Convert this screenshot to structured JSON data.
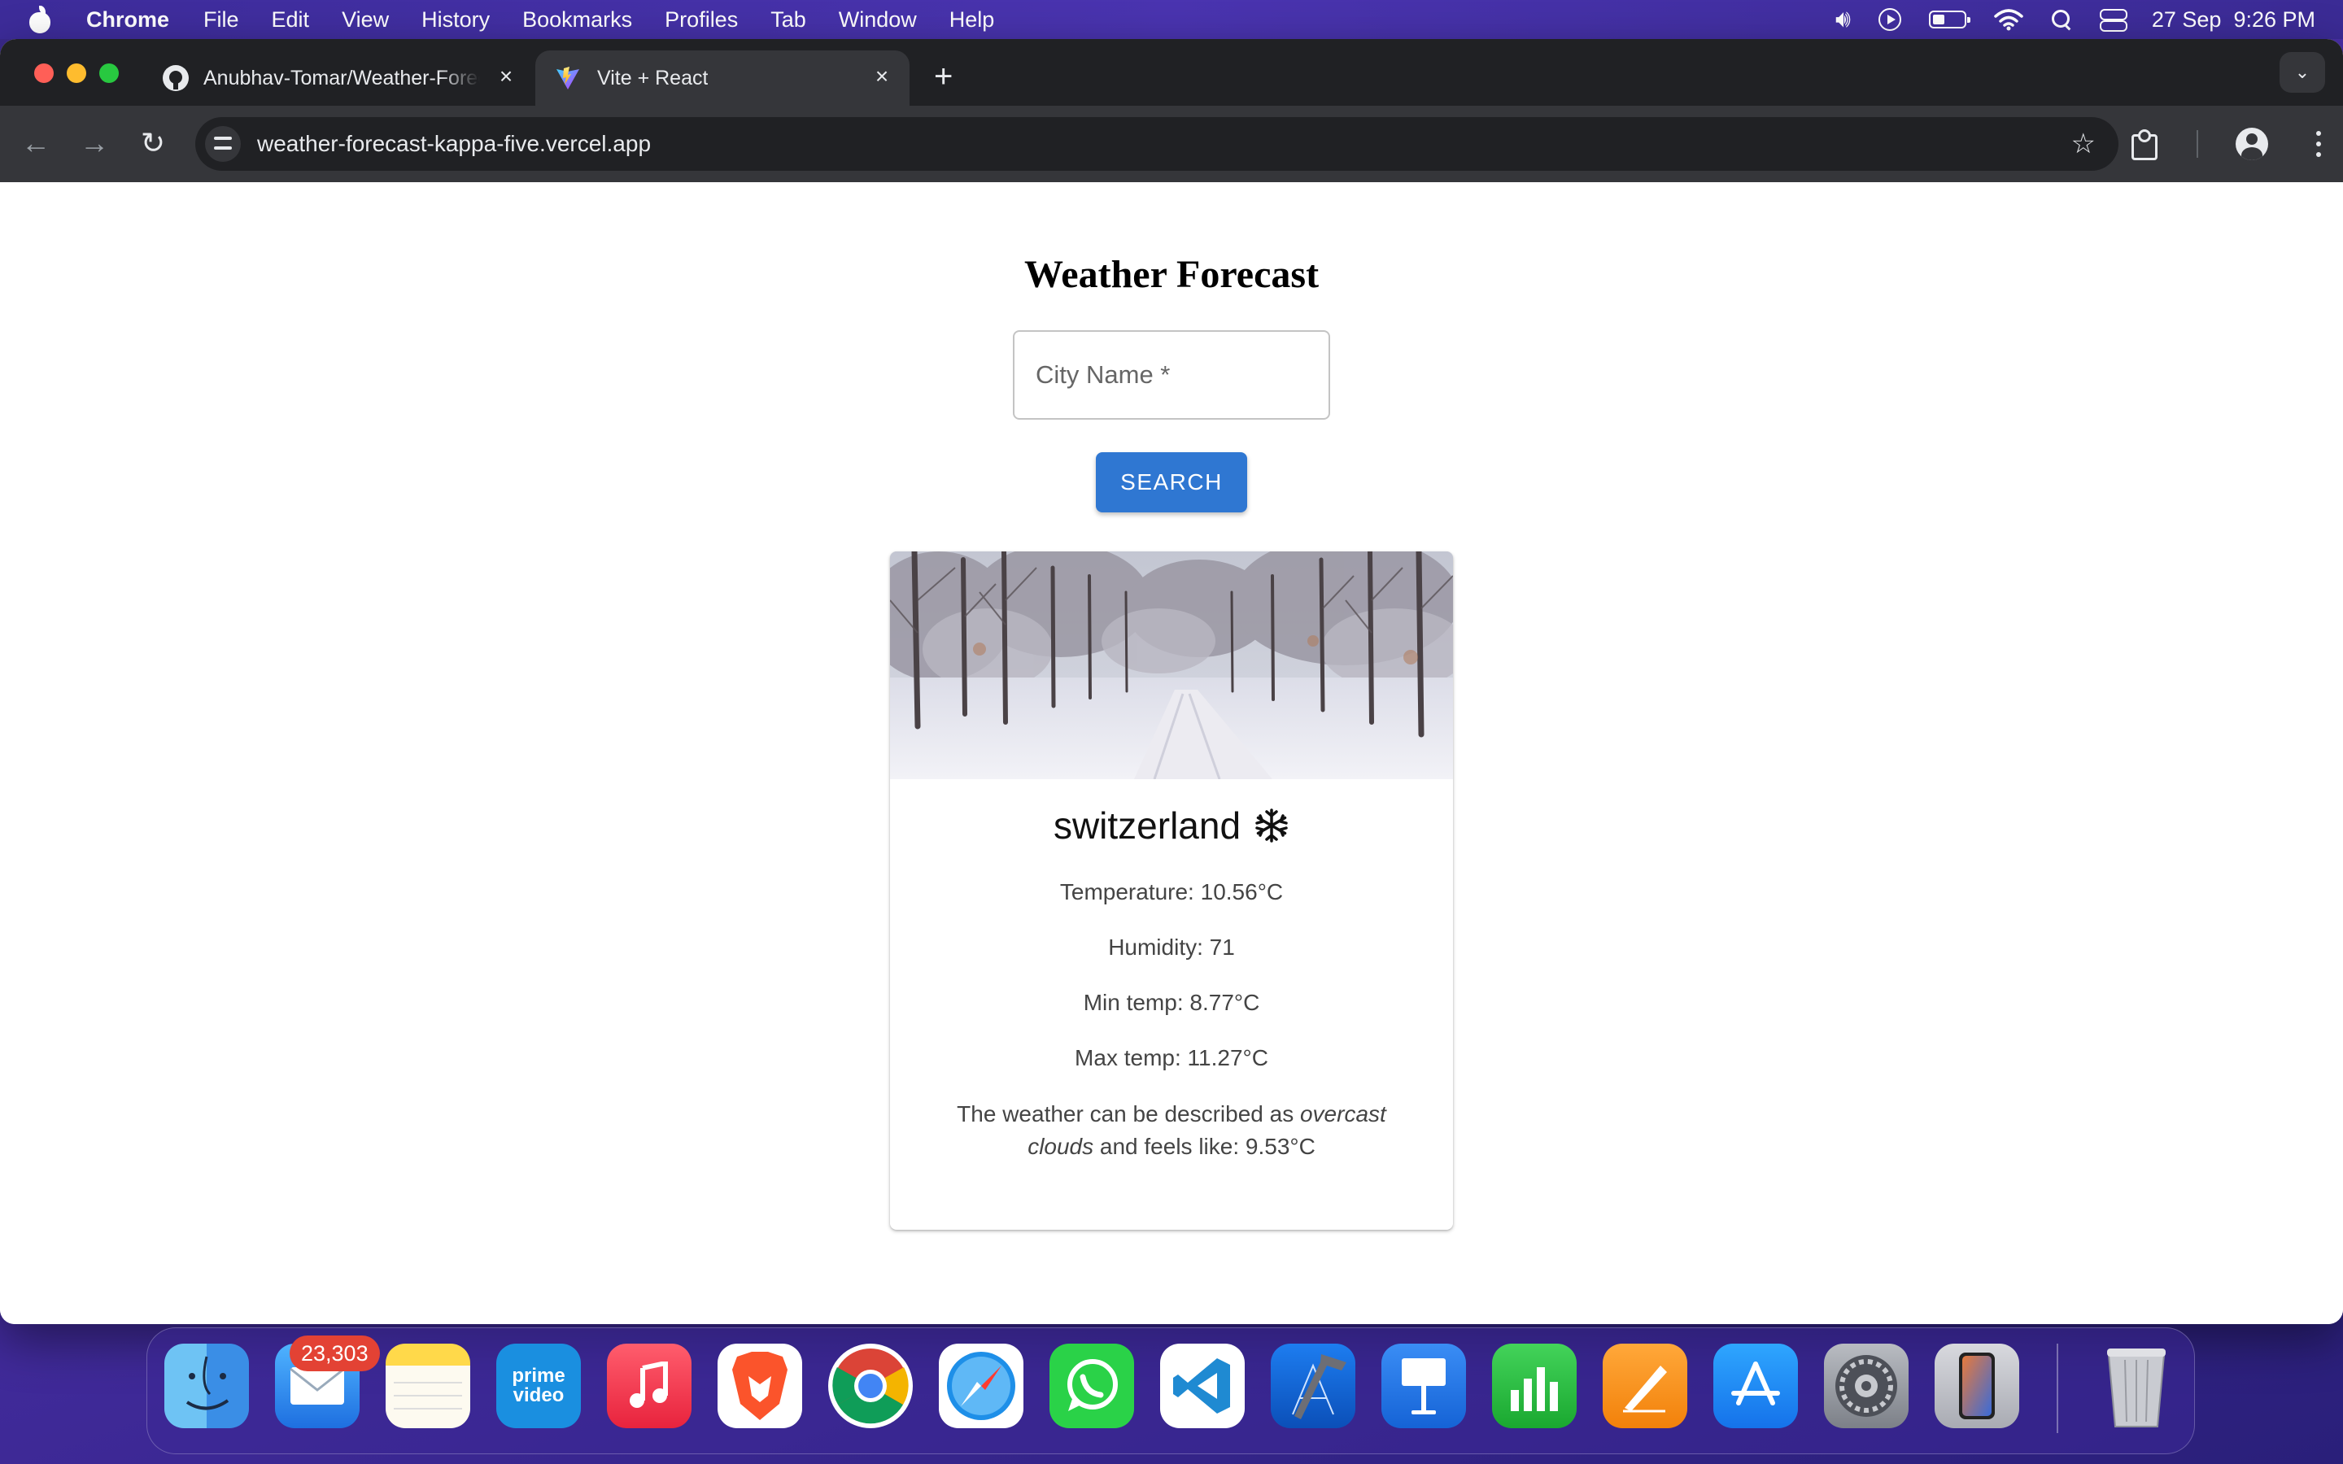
{
  "menubar": {
    "app": "Chrome",
    "items": [
      "File",
      "Edit",
      "View",
      "History",
      "Bookmarks",
      "Profiles",
      "Tab",
      "Window",
      "Help"
    ],
    "date": "27 Sep",
    "time": "9:26 PM"
  },
  "browser": {
    "tabs": [
      {
        "title": "Anubhav-Tomar/Weather-Forecast",
        "favicon": "github-icon",
        "active": false
      },
      {
        "title": "Vite + React",
        "favicon": "vite-icon",
        "active": true
      }
    ],
    "url": "weather-forecast-kappa-five.vercel.app"
  },
  "page": {
    "title": "Weather Forecast",
    "search": {
      "placeholder": "City Name *",
      "value": "",
      "button_label": "SEARCH"
    },
    "card": {
      "city": "switzerland",
      "weather_icon": "snowflake-icon",
      "temperature": "Temperature: 10.56°C",
      "humidity": "Humidity: 71",
      "min_temp": "Min temp: 8.77°C",
      "max_temp": "Max temp: 11.27°C",
      "desc_prefix": "The weather can be described as ",
      "desc_condition": "overcast clouds",
      "desc_suffix": " and feels like: 9.53°C"
    }
  },
  "dock": {
    "mail_badge": "23,303",
    "apps": [
      "Finder",
      "Mail",
      "Notes",
      "Prime Video",
      "Music",
      "Brave",
      "Chrome",
      "Safari",
      "WhatsApp",
      "VS Code",
      "Xcode",
      "Keynote",
      "Numbers",
      "Pages",
      "App Store",
      "System Settings",
      "iPhone Mirroring",
      "Trash"
    ],
    "prime_label_1": "prime",
    "prime_label_2": "video"
  },
  "colors": {
    "accent": "#2f77d2",
    "chrome_dark": "#202124",
    "chrome_toolbar": "#35363a",
    "badge": "#e34234"
  }
}
